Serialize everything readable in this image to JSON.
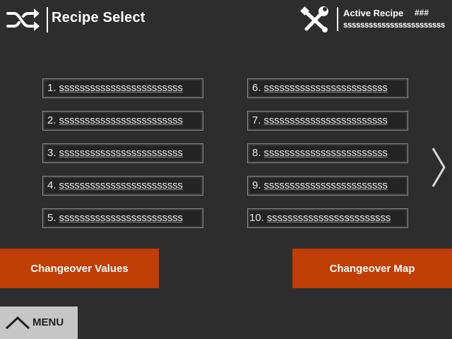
{
  "header": {
    "title": "Recipe Select",
    "active_recipe_label": "Active Recipe",
    "active_recipe_number": "###",
    "active_recipe_name": "ssssssssssssssssssssssss"
  },
  "recipes": [
    {
      "num": "1.",
      "name": "ssssssssssssssssssssssss"
    },
    {
      "num": "2.",
      "name": "ssssssssssssssssssssssss"
    },
    {
      "num": "3.",
      "name": "ssssssssssssssssssssssss"
    },
    {
      "num": "4.",
      "name": "ssssssssssssssssssssssss"
    },
    {
      "num": "5.",
      "name": "ssssssssssssssssssssssss"
    },
    {
      "num": "6.",
      "name": "ssssssssssssssssssssssss"
    },
    {
      "num": "7.",
      "name": "ssssssssssssssssssssssss"
    },
    {
      "num": "8.",
      "name": "ssssssssssssssssssssssss"
    },
    {
      "num": "9.",
      "name": "ssssssssssssssssssssssss"
    },
    {
      "num": "10.",
      "name": "ssssssssssssssssssssssss"
    }
  ],
  "actions": {
    "changeover_values": "Changeover Values",
    "changeover_map": "Changeover Map"
  },
  "menu": {
    "label": "MENU"
  },
  "icons": {
    "shuffle": "shuffle-icon",
    "tools": "tools-icon",
    "next": "chevron-right-icon",
    "menu": "chevron-up-icon"
  },
  "colors": {
    "background": "#2d2d2d",
    "accent": "#c03d06",
    "menu_button": "#c6c6c6"
  }
}
